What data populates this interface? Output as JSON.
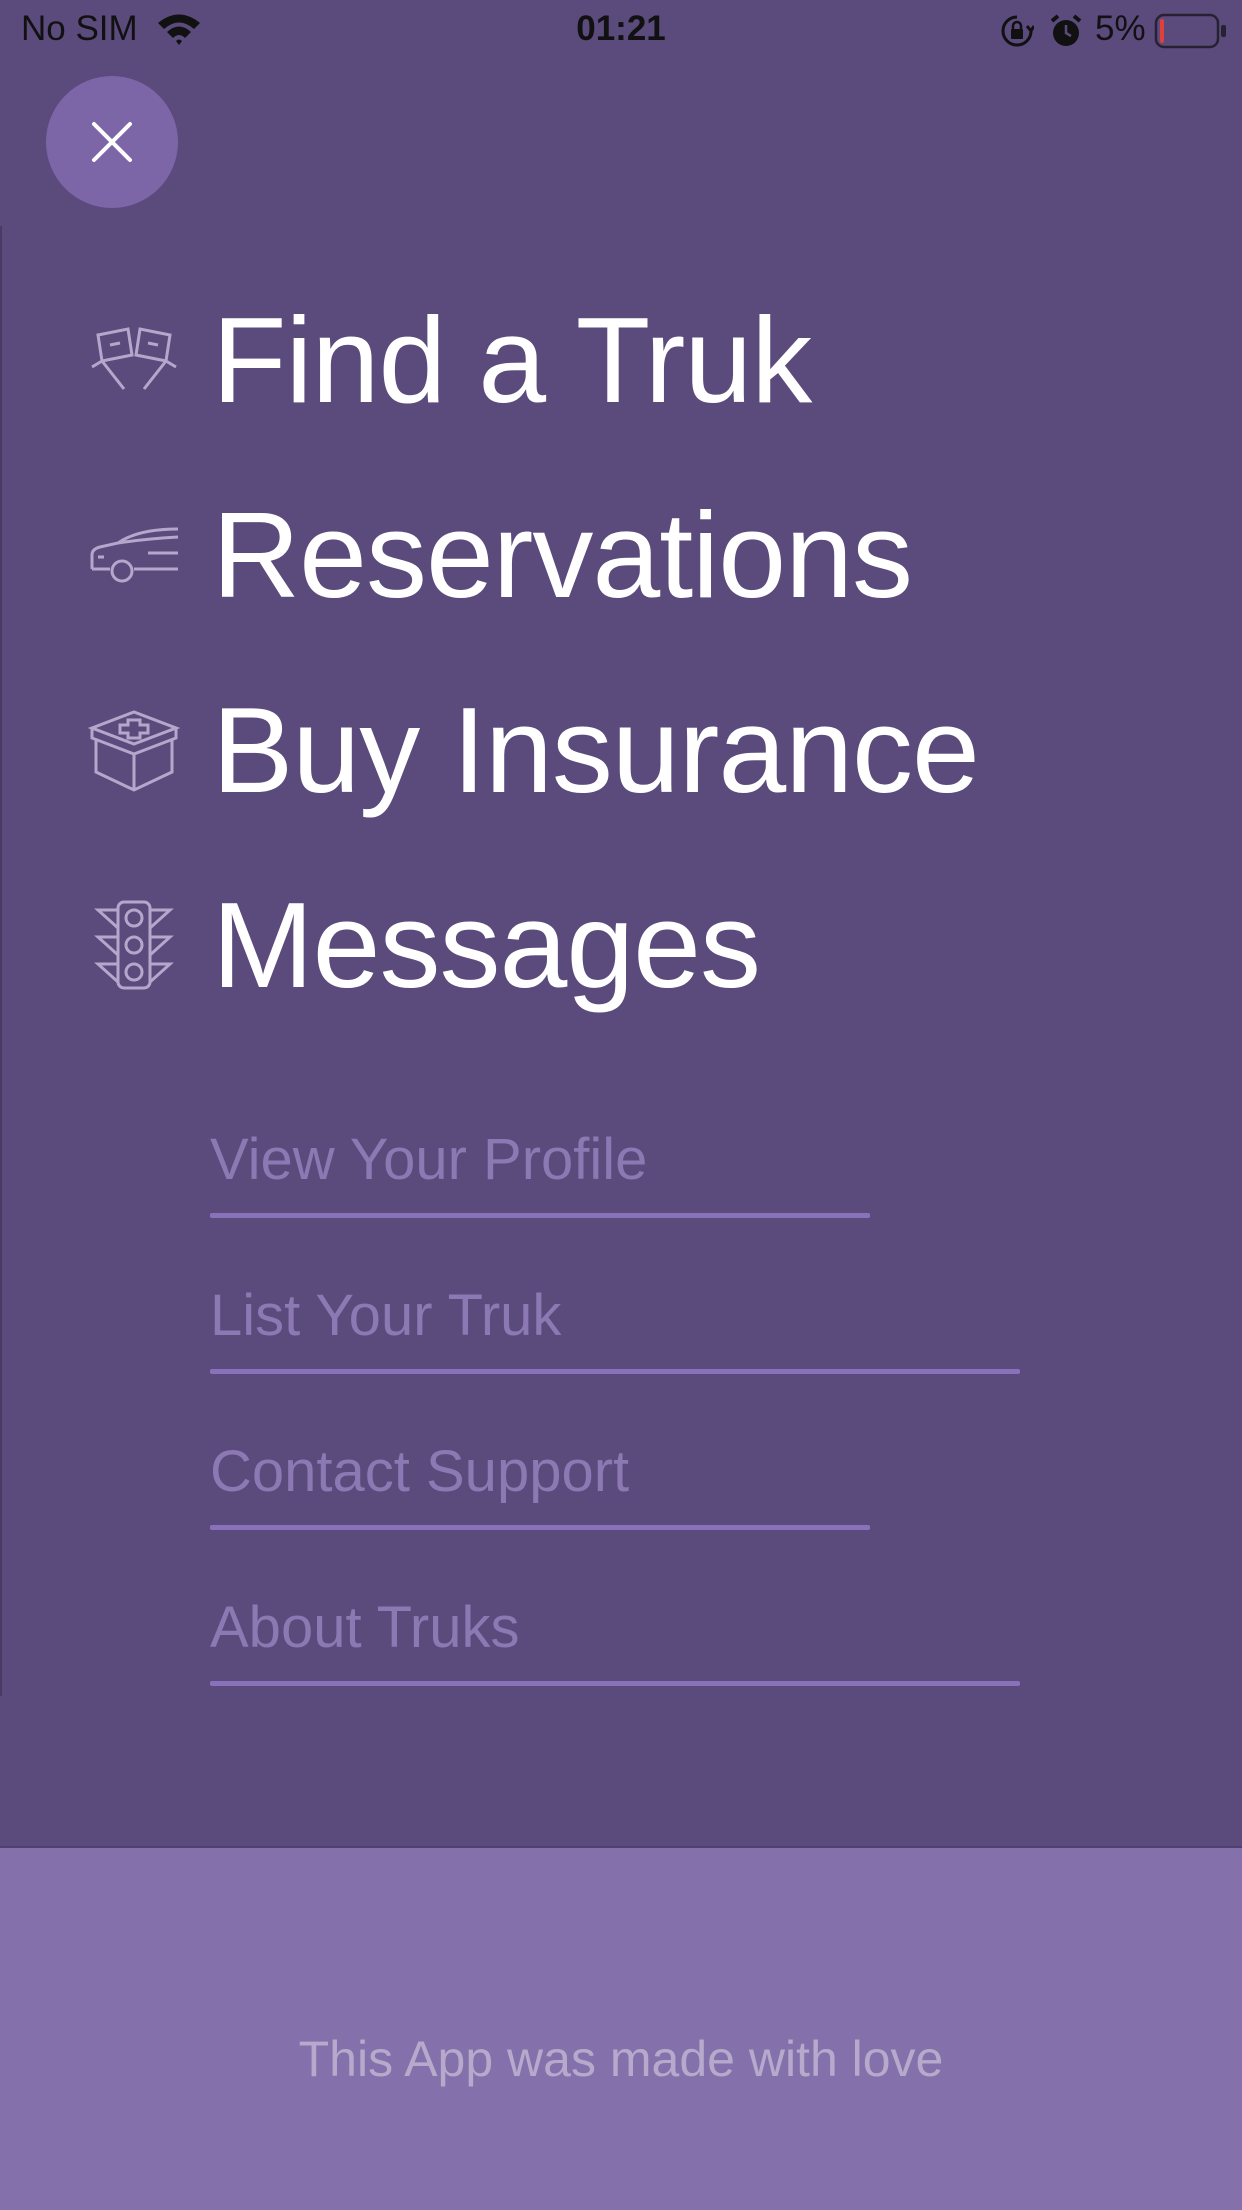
{
  "status_bar": {
    "carrier": "No SIM",
    "time": "01:21",
    "battery_percent": "5%",
    "icons": [
      "wifi-icon",
      "rotation-lock-icon",
      "alarm-icon",
      "battery-icon"
    ]
  },
  "close_button": {
    "icon": "close-icon"
  },
  "main_menu": [
    {
      "label": "Find a Truk",
      "icon": "flags-icon"
    },
    {
      "label": "Reservations",
      "icon": "car-icon"
    },
    {
      "label": "Buy Insurance",
      "icon": "first-aid-box-icon"
    },
    {
      "label": "Messages",
      "icon": "traffic-light-icon"
    }
  ],
  "secondary_menu": [
    {
      "label": "View Your Profile"
    },
    {
      "label": "List Your Truk"
    },
    {
      "label": "Contact Support"
    },
    {
      "label": "About Truks"
    }
  ],
  "footer": {
    "text": "This App was made with love"
  },
  "colors": {
    "background": "#5b4a7c",
    "footer_background": "#8470aa",
    "close_button": "#7d66a8",
    "primary_text": "#ffffff",
    "secondary_text": "#8c78b2",
    "underline": "#8a72ba"
  }
}
